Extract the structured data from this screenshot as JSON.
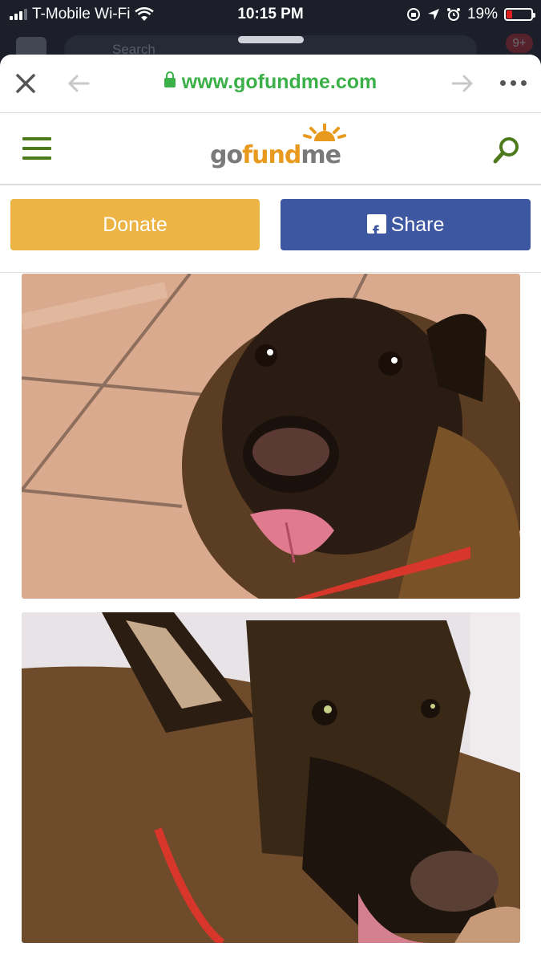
{
  "status_bar": {
    "carrier": "T-Mobile Wi-Fi",
    "time": "10:15 PM",
    "battery_percent": "19%"
  },
  "background_app": {
    "search_placeholder": "Search",
    "notification_badge": "9+"
  },
  "browser": {
    "url": "www.gofundme.com"
  },
  "site_header": {
    "logo_text_go": "go",
    "logo_text_fund": "fund",
    "logo_text_me": "me"
  },
  "actions": {
    "donate_label": "Donate",
    "share_label": "Share"
  },
  "colors": {
    "brand_green": "#3cb048",
    "donate_yellow": "#ebb445",
    "share_blue": "#3d57a0",
    "menu_green": "#4e7a1e"
  },
  "photos": [
    {
      "icon": "photo-dog-1"
    },
    {
      "icon": "photo-dog-2"
    }
  ]
}
